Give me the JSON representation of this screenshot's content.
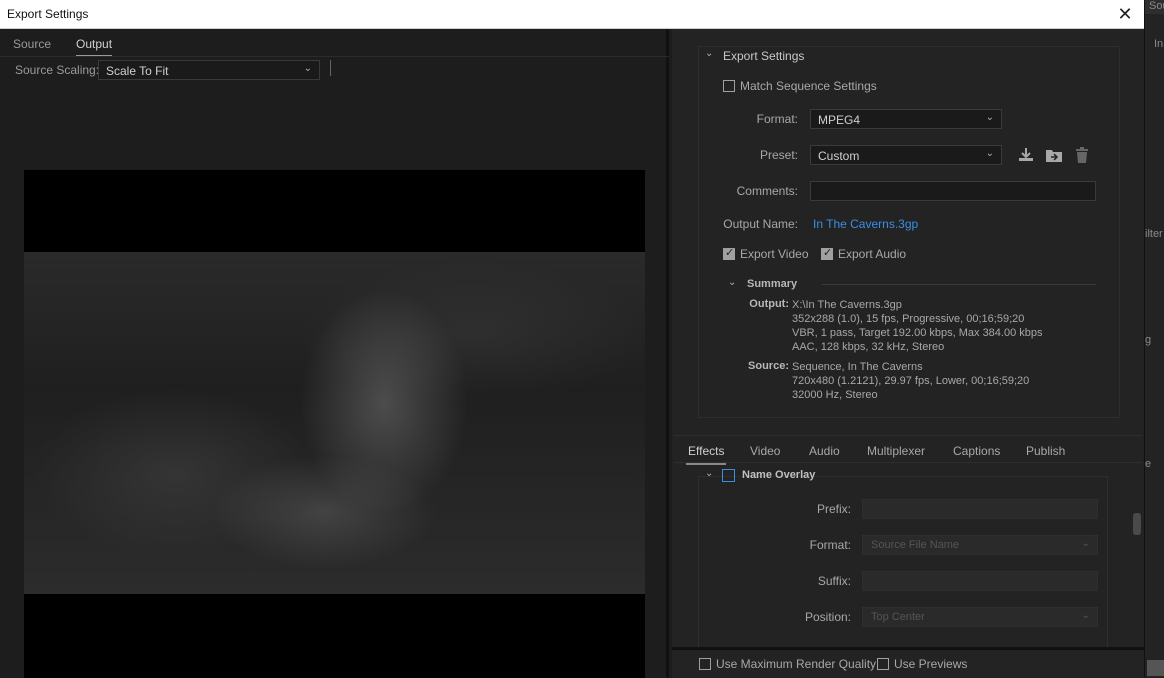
{
  "window": {
    "title": "Export Settings",
    "close_glyph": "✕"
  },
  "left": {
    "tabs": [
      {
        "label": "Source",
        "active": false
      },
      {
        "label": "Output",
        "active": true
      }
    ],
    "source_scaling_label": "Source Scaling:",
    "source_scaling_value": "Scale To Fit"
  },
  "export_settings": {
    "header": "Export Settings",
    "match_sequence_label": "Match Sequence Settings",
    "match_sequence_checked": false,
    "format_label": "Format:",
    "format_value": "MPEG4",
    "preset_label": "Preset:",
    "preset_value": "Custom",
    "preset_icons": [
      "save-preset-icon",
      "import-preset-icon",
      "delete-preset-icon"
    ],
    "comments_label": "Comments:",
    "comments_value": "",
    "output_name_label": "Output Name:",
    "output_name_value": "In The Caverns.3gp",
    "export_video_label": "Export Video",
    "export_video_checked": true,
    "export_audio_label": "Export Audio",
    "export_audio_checked": true
  },
  "summary": {
    "header": "Summary",
    "output_key": "Output:",
    "output_lines": [
      "X:\\In The Caverns.3gp",
      "352x288 (1.0), 15 fps, Progressive, 00;16;59;20",
      "VBR, 1 pass, Target 192.00 kbps, Max 384.00 kbps",
      "AAC, 128 kbps, 32 kHz, Stereo"
    ],
    "source_key": "Source:",
    "source_lines": [
      "Sequence, In The Caverns",
      "720x480 (1.2121), 29.97 fps, Lower, 00;16;59;20",
      "32000 Hz, Stereo"
    ]
  },
  "bottom_tabs": [
    {
      "label": "Effects",
      "active": true
    },
    {
      "label": "Video",
      "active": false
    },
    {
      "label": "Audio",
      "active": false
    },
    {
      "label": "Multiplexer",
      "active": false
    },
    {
      "label": "Captions",
      "active": false
    },
    {
      "label": "Publish",
      "active": false
    }
  ],
  "name_overlay": {
    "header": "Name Overlay",
    "enabled": false,
    "prefix_label": "Prefix:",
    "prefix_value": "",
    "format_label": "Format:",
    "format_value": "Source File Name",
    "suffix_label": "Suffix:",
    "suffix_value": "",
    "position_label": "Position:",
    "position_value": "Top Center"
  },
  "footer": {
    "max_render_label": "Use Maximum Render Quality",
    "max_render_checked": false,
    "use_previews_label": "Use Previews",
    "use_previews_checked": false
  },
  "background_app": {
    "texts": [
      "Sou",
      "In",
      "ilter",
      "g",
      "e"
    ]
  },
  "colors": {
    "accent": "#3a8ee6",
    "panel_bg": "#232323",
    "left_bg": "#1d1d1d"
  }
}
